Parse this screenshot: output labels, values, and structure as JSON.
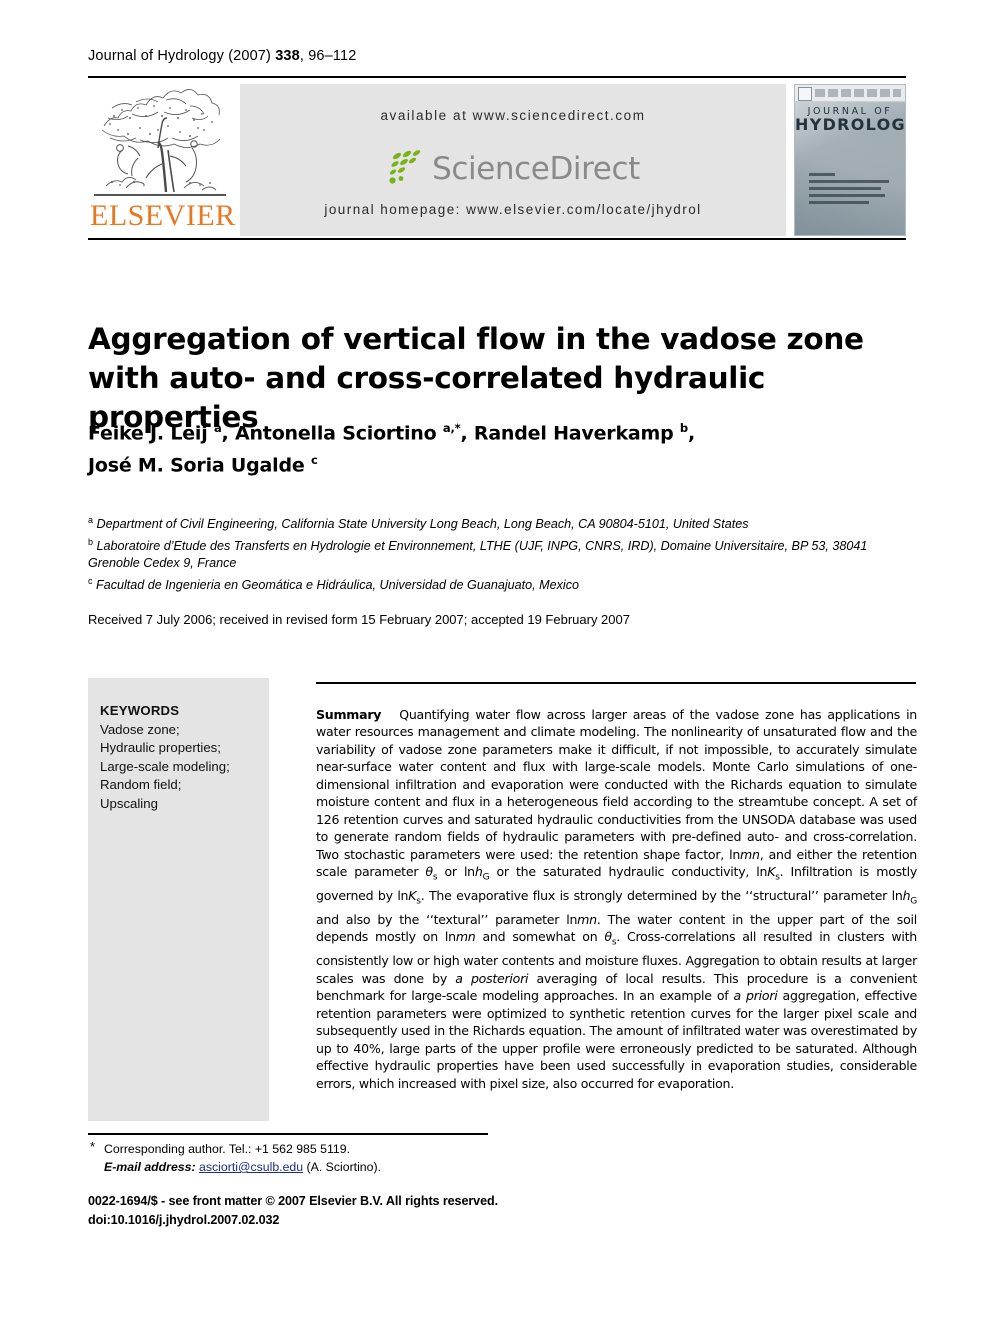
{
  "running_head": {
    "journal": "Journal of Hydrology",
    "year": "(2007)",
    "volume": "338",
    "pages": ", 96–112"
  },
  "masthead": {
    "available_at": "available at www.sciencedirect.com",
    "sciencedirect_word": "ScienceDirect",
    "journal_homepage": "journal homepage: www.elsevier.com/locate/jhydrol",
    "publisher": "ELSEVIER",
    "cover_title_line1": "JOURNAL OF",
    "cover_title_line2": "HYDROLOGY"
  },
  "article": {
    "title_line1": "Aggregation of vertical flow in the vadose zone",
    "title_line2": "with auto- and cross-correlated hydraulic properties",
    "authors_line1": "Feike J. Leij ",
    "authors_line1_sup1": "a",
    "authors_line1_mid1": ", Antonella Sciortino ",
    "authors_line1_sup2": "a,*",
    "authors_line1_mid2": ", Randel Haverkamp ",
    "authors_line1_sup3": "b",
    "authors_line1_end": ",",
    "authors_line2": "José M. Soria Ugalde ",
    "authors_line2_sup": "c",
    "affiliation_a_sup": "a",
    "affiliation_a": "Department of Civil Engineering, California State University Long Beach, Long Beach, CA 90804-5101, United States",
    "affiliation_b_sup": "b",
    "affiliation_b": "Laboratoire d’Etude des Transferts en Hydrologie et Environnement, LTHE (UJF, INPG, CNRS, IRD), Domaine Universitaire, BP 53, 38041 Grenoble Cedex 9, France",
    "affiliation_c_sup": "c",
    "affiliation_c": "Facultad de Ingenieria en Geomática e Hidráulica, Universidad de Guanajuato, Mexico",
    "history": "Received 7 July 2006; received in revised form 15 February 2007; accepted 19 February 2007"
  },
  "keywords": {
    "heading": "KEYWORDS",
    "items": [
      "Vadose zone;",
      "Hydraulic properties;",
      "Large-scale modeling;",
      "Random field;",
      "Upscaling"
    ]
  },
  "abstract": {
    "label": "Summary",
    "p1": "Quantifying water flow across larger areas of the vadose zone has applications in water resources management and climate modeling. The nonlinearity of unsaturated flow and the variability of vadose zone parameters make it difficult, if not impossible, to accurately simulate near-surface water content and flux with large-scale models. Monte Carlo simulations of one-dimensional infiltration and evaporation were conducted with the Richards equation to simulate moisture content and flux in a heterogeneous field according to the streamtube concept. A set of 126 retention curves and saturated hydraulic conductivities from the UNSODA database was used to generate random fields of hydraulic parameters with pre-defined auto- and cross-correlation. Two stochastic parameters were used: the retention shape factor, ln",
    "sym_mn_1": "mn",
    "p2": ", and either the retention scale parameter ",
    "sym_theta_1": "θ",
    "sym_theta_1_sub": "s",
    "p3": " or ln",
    "sym_h_1": "h",
    "sym_h_1_sub": "G",
    "p4": " or the saturated hydraulic conductivity, ln",
    "sym_K_1": "K",
    "sym_K_1_sub": "s",
    "p5": ". Infiltration is mostly governed by ln",
    "sym_K_2": "K",
    "sym_K_2_sub": "s",
    "p6": ". The evaporative flux is strongly determined by the ‘‘structural’’ parameter ln",
    "sym_h_2": "h",
    "sym_h_2_sub": "G",
    "p7": " and also by the ‘‘textural’’ parameter ln",
    "sym_mn_2": "mn",
    "p8": ". The water content in the upper part of the soil depends mostly on ln",
    "sym_mn_3": "mn",
    "p9": " and somewhat on ",
    "sym_theta_2": "θ",
    "sym_theta_2_sub": "s",
    "p10": ". Cross-correlations all resulted in clusters with consistently low or high water contents and moisture fluxes. Aggregation to obtain results at larger scales was done by ",
    "it_aposteriori": "a posteriori",
    "p11": " averaging of local results. This procedure is a convenient benchmark for large-scale modeling approaches. In an example of ",
    "it_apriori": "a priori",
    "p12": " aggregation, effective retention parameters were optimized to synthetic retention curves for the larger pixel scale and subsequently used in the Richards equation. The amount of infiltrated water was overestimated by up to 40%, large parts of the upper profile were erroneously predicted to be saturated. Although effective hydraulic properties have been used successfully in evaporation studies, considerable errors, which increased with pixel size, also occurred for evaporation."
  },
  "footnotes": {
    "corresponding_marker": "*",
    "corresponding": "Corresponding author. Tel.: +1 562 985 5119.",
    "email_label": "E-mail address:",
    "email": "asciorti@csulb.edu",
    "email_suffix": "(A. Sciortino)."
  },
  "colophon": {
    "line1": "0022-1694/$ - see front matter © 2007 Elsevier B.V. All rights reserved.",
    "line2": "doi:10.1016/j.jhydrol.2007.02.032"
  },
  "colors": {
    "elsevier_orange": "#E87722",
    "sciencedirect_gray": "#8a8a8a",
    "sciencedirect_green": "#7ab317",
    "band_gray": "#e4e4e4",
    "email_blue": "#1b2f8a"
  }
}
